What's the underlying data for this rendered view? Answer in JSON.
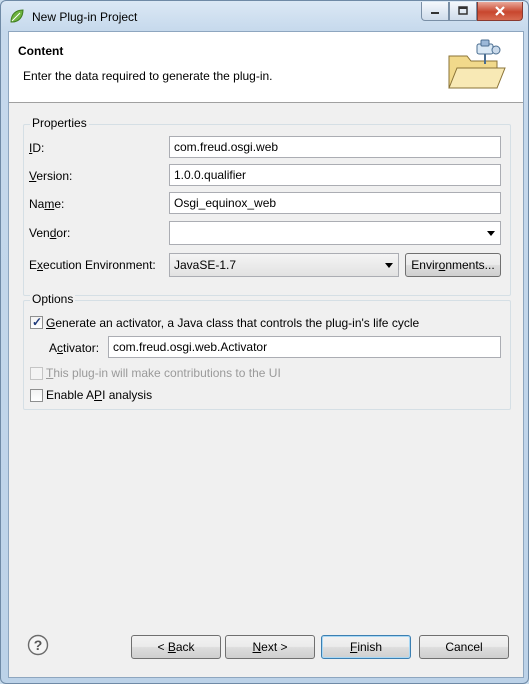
{
  "window": {
    "title": "New Plug-in Project"
  },
  "header": {
    "title": "Content",
    "description": "Enter the data required to generate the plug-in."
  },
  "properties": {
    "group_label": "Properties",
    "id": {
      "label_u": "I",
      "label_rest": "D:",
      "value": "com.freud.osgi.web"
    },
    "version": {
      "label_u": "V",
      "label_rest": "ersion:",
      "value": "1.0.0.qualifier"
    },
    "name": {
      "label_pre": "Na",
      "label_u": "m",
      "label_rest": "e:",
      "value": "Osgi_equinox_web"
    },
    "vendor": {
      "label_pre": "Ven",
      "label_u": "d",
      "label_rest": "or:",
      "value": ""
    },
    "environment": {
      "label_pre": "E",
      "label_u": "x",
      "label_rest": "ecution Environment:",
      "value": "JavaSE-1.7"
    },
    "environments_button": {
      "pre": "Envir",
      "u": "o",
      "rest": "nments..."
    }
  },
  "options": {
    "group_label": "Options",
    "generate_activator": {
      "u": "G",
      "rest": "enerate an activator, a Java class that controls the plug-in's life cycle",
      "checked": true
    },
    "activator": {
      "label_pre": "A",
      "label_u": "c",
      "label_rest": "tivator:",
      "value": "com.freud.osgi.web.Activator"
    },
    "ui_contrib": {
      "u": "T",
      "rest": "his plug-in will make contributions to the UI",
      "checked": false,
      "enabled": false
    },
    "api_analysis": {
      "pre": "Enable A",
      "u": "P",
      "rest": "I analysis",
      "checked": false
    }
  },
  "footer": {
    "back": {
      "pre": "< ",
      "u": "B",
      "rest": "ack"
    },
    "next": {
      "u": "N",
      "rest": "ext >"
    },
    "finish": {
      "u": "F",
      "rest": "inish"
    },
    "cancel": "Cancel"
  },
  "icons": [
    "spring-leaf-icon",
    "minimize-icon",
    "maximize-icon",
    "close-icon",
    "plugin-folder-icon",
    "help-icon",
    "checkmark-icon",
    "dropdown-arrow-icon"
  ],
  "colors": {
    "accent": "#3c7fb1",
    "titlebar": "#c6d9ec",
    "close": "#c8462e"
  }
}
